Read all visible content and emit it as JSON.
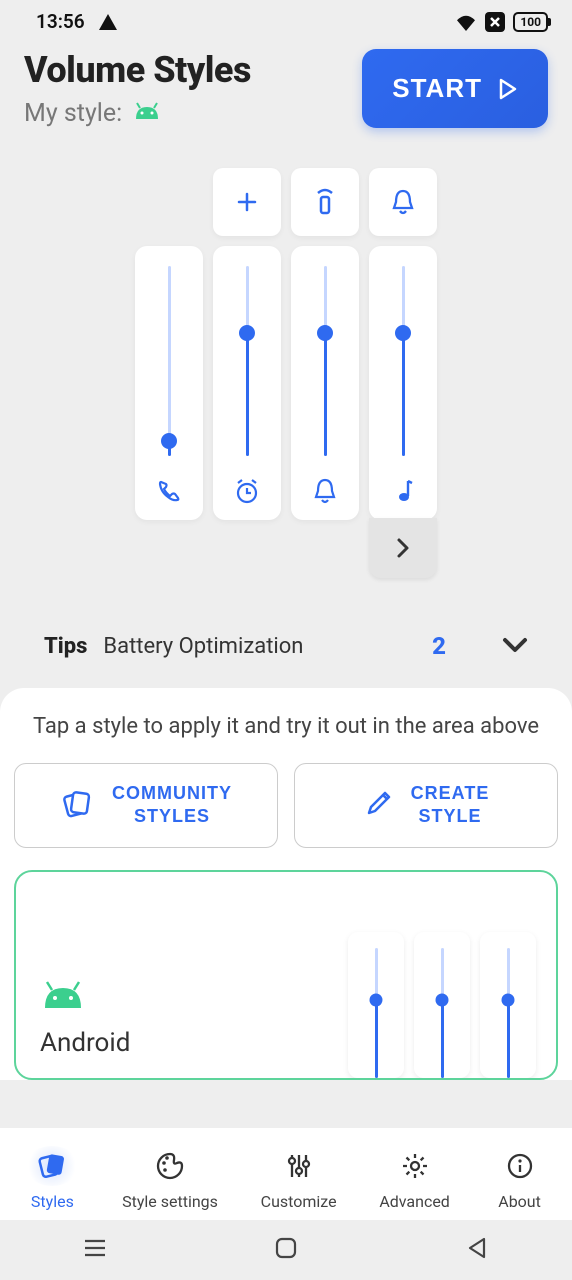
{
  "status": {
    "time": "13:56",
    "battery": "100"
  },
  "header": {
    "title": "Volume Styles",
    "subtitle": "My style:",
    "start": "START"
  },
  "sliders": [
    {
      "icon": "phone",
      "value": 8
    },
    {
      "icon": "alarm",
      "value": 65
    },
    {
      "icon": "notify",
      "value": 65
    },
    {
      "icon": "music",
      "value": 65
    }
  ],
  "tips": {
    "label": "Tips",
    "text": "Battery Optimization",
    "count": "2"
  },
  "card": {
    "tap": "Tap a style to apply it and try it out in the area above",
    "community": "COMMUNITY\nSTYLES",
    "create": "CREATE\nSTYLE"
  },
  "style": {
    "name": "Android",
    "preview": [
      60,
      60,
      60
    ]
  },
  "nav": {
    "styles": "Styles",
    "settings": "Style settings",
    "custom": "Customize",
    "advanced": "Advanced",
    "about": "About"
  }
}
